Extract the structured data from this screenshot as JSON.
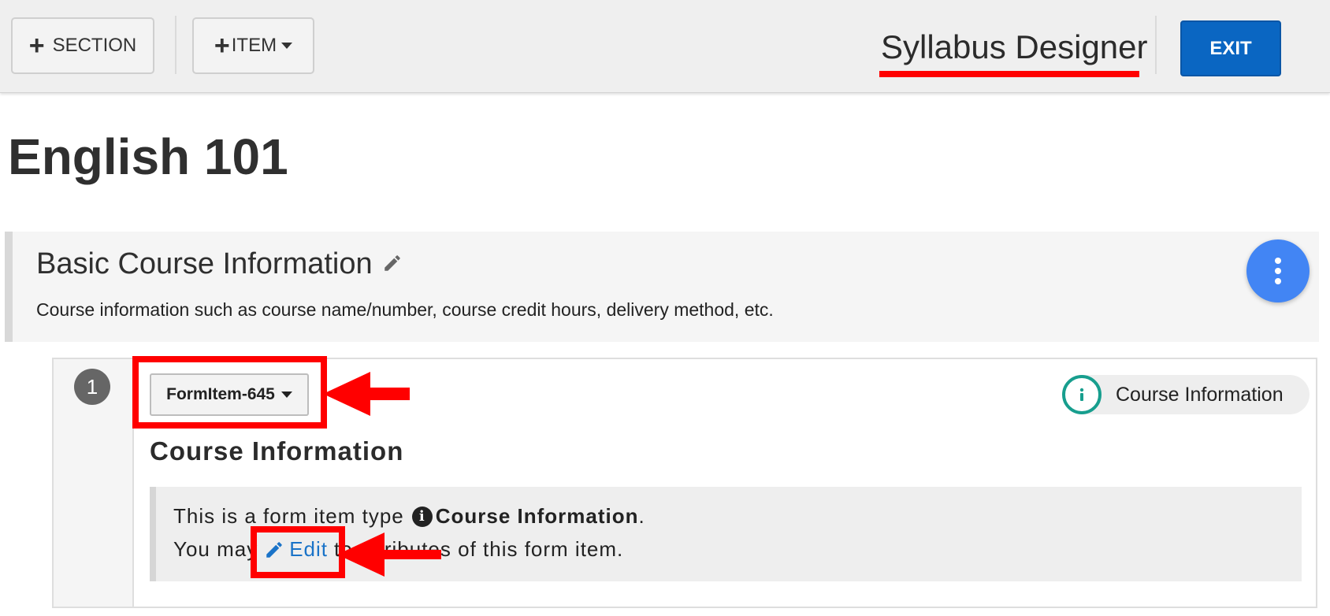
{
  "toolbar": {
    "section_button": "SECTION",
    "item_button": "ITEM",
    "app_title": "Syllabus Designer",
    "exit_button": "EXIT"
  },
  "course": {
    "title": "English 101"
  },
  "section": {
    "title": "Basic Course Information",
    "description": "Course information such as course name/number, course credit hours, delivery method, etc."
  },
  "form_item": {
    "number": "1",
    "id_button": "FormItem-645",
    "type_badge": "Course Information",
    "heading": "Course Information",
    "info_prefix": "This is a form item type",
    "info_type": "Course Information",
    "info_period": ".",
    "info_line2_start": "You may",
    "edit_link": "Edit",
    "info_line2_end": "to attributes of this form item."
  },
  "colors": {
    "toolbar_bg": "#efefef",
    "exit_blue": "#0a66c2",
    "fab_blue": "#4285f4",
    "badge_teal": "#179e8e",
    "link_blue": "#1a73c8",
    "annotation_red": "#ff0000"
  },
  "icons": [
    "plus-icon",
    "caret-down-icon",
    "pencil-icon",
    "more-vert-icon",
    "info-icon",
    "arrow-annotation"
  ]
}
